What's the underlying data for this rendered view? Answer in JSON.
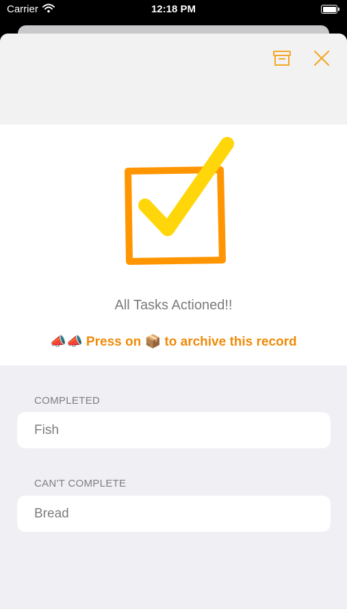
{
  "status_bar": {
    "carrier": "Carrier",
    "time": "12:18 PM",
    "icons": [
      "wifi-icon",
      "battery-icon"
    ]
  },
  "header": {
    "buttons": [
      "archive-icon",
      "close-icon"
    ],
    "accent_color": "#F5A623"
  },
  "hero": {
    "icon": "checkbox-check-icon",
    "title": "All Tasks Actioned!!",
    "hint": "📣📣 Press on 📦 to archive this record",
    "hint_color": "#EF8B0A",
    "box_color": "#FF9500",
    "check_color": "#FFD60A"
  },
  "sections": [
    {
      "header": "COMPLETED",
      "items": [
        "Fish"
      ]
    },
    {
      "header": "CAN'T COMPLETE",
      "items": [
        "Bread"
      ]
    }
  ]
}
